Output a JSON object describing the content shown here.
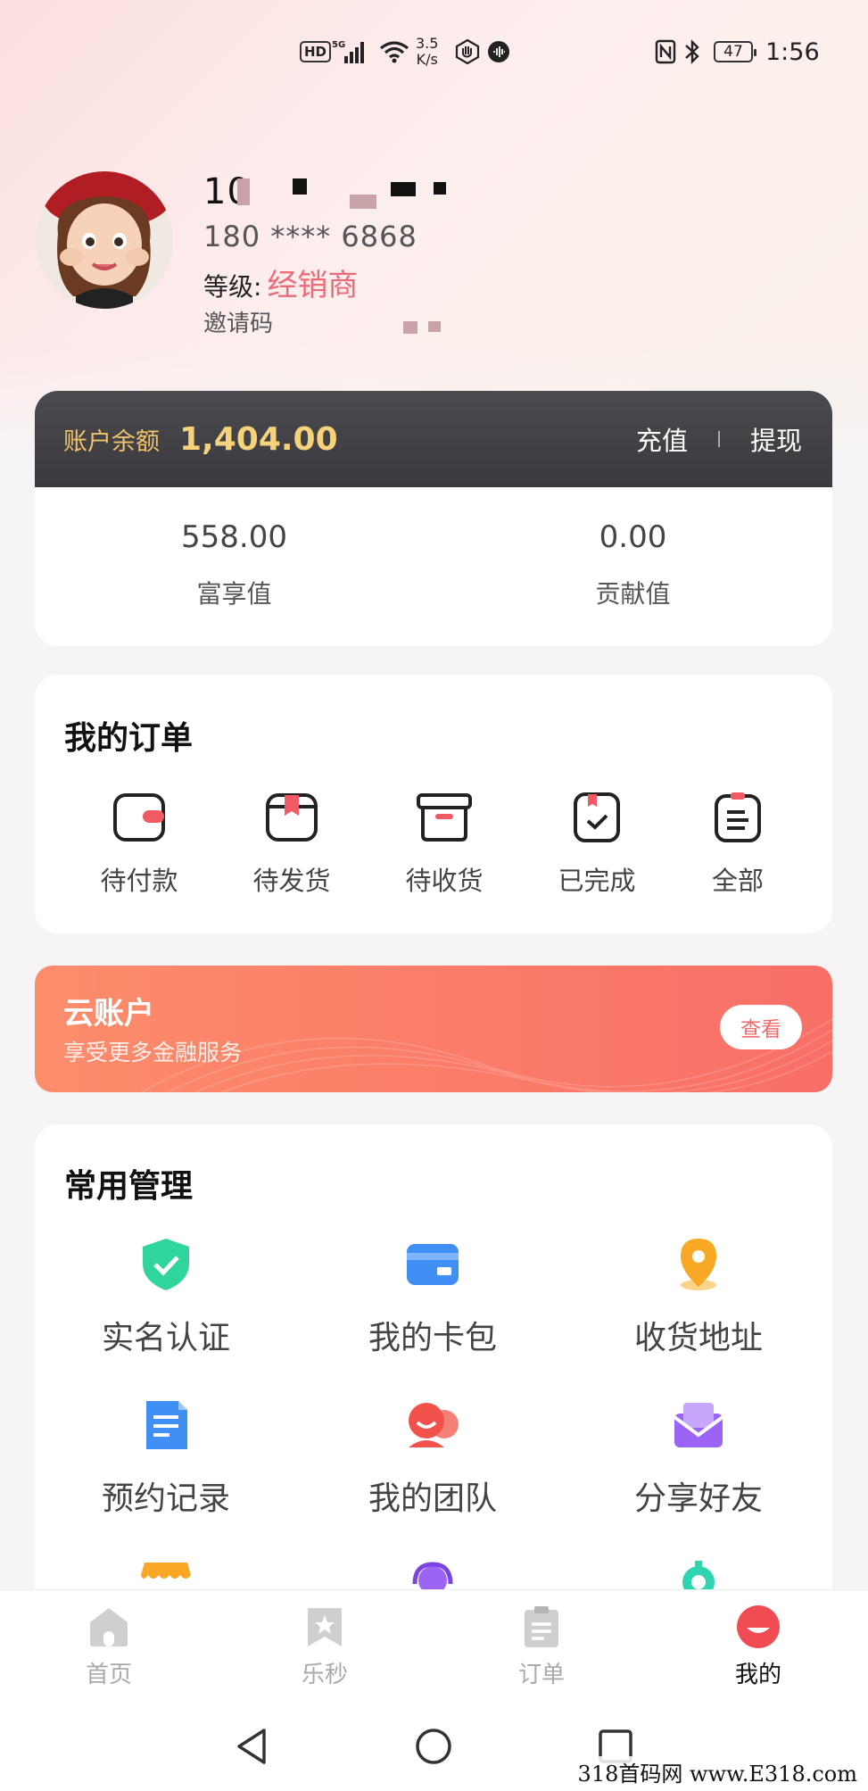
{
  "status_bar": {
    "hd": "HD",
    "network": "5G",
    "speed_value": "3.5",
    "speed_unit": "K/s",
    "battery": "47",
    "time": "1:56"
  },
  "profile": {
    "user_id": "10",
    "phone": "180 **** 6868",
    "level_label": "等级:",
    "level_value": "经销商",
    "invite_label": "邀请码"
  },
  "balance": {
    "label": "账户余额",
    "value": "1,404.00",
    "recharge": "充值",
    "withdraw": "提现",
    "stats": [
      {
        "value": "558.00",
        "label": "富享值"
      },
      {
        "value": "0.00",
        "label": "贡献值"
      }
    ]
  },
  "orders": {
    "title": "我的订单",
    "items": [
      {
        "label": "待付款",
        "icon": "wallet-icon"
      },
      {
        "label": "待发货",
        "icon": "box-icon"
      },
      {
        "label": "待收货",
        "icon": "package-icon"
      },
      {
        "label": "已完成",
        "icon": "completed-icon"
      },
      {
        "label": "全部",
        "icon": "list-icon"
      }
    ]
  },
  "cloud_account": {
    "title": "云账户",
    "subtitle": "享受更多金融服务",
    "button": "查看"
  },
  "manage": {
    "title": "常用管理",
    "items": [
      {
        "label": "实名认证",
        "icon": "shield-check-icon"
      },
      {
        "label": "我的卡包",
        "icon": "card-icon"
      },
      {
        "label": "收货地址",
        "icon": "location-pin-icon"
      },
      {
        "label": "预约记录",
        "icon": "document-icon"
      },
      {
        "label": "我的团队",
        "icon": "team-icon"
      },
      {
        "label": "分享好友",
        "icon": "mail-share-icon"
      }
    ]
  },
  "bottom_nav": {
    "items": [
      {
        "label": "首页",
        "icon": "home-icon"
      },
      {
        "label": "乐秒",
        "icon": "bookmark-star-icon"
      },
      {
        "label": "订单",
        "icon": "clipboard-icon"
      },
      {
        "label": "我的",
        "icon": "profile-icon"
      }
    ],
    "active": "我的"
  },
  "watermark": "318首码网 www.E318.com",
  "colors": {
    "accent_red": "#ec6b7a",
    "gold": "#f6d27b",
    "banner_orange": "#fb7c68",
    "dark_header": "#3a3a3e"
  }
}
